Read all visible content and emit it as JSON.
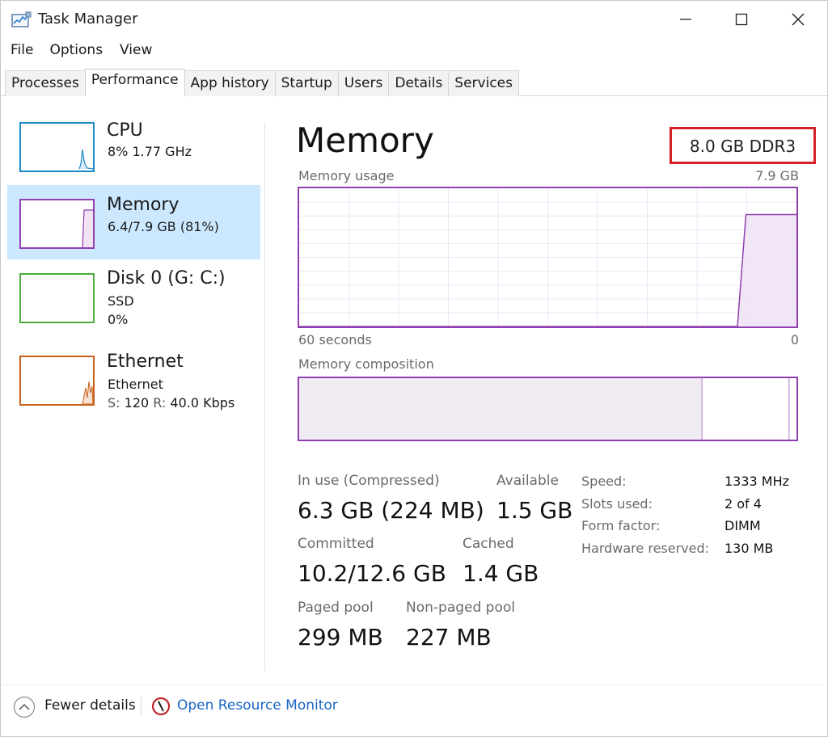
{
  "window": {
    "title": "Task Manager"
  },
  "menu": [
    "File",
    "Options",
    "View"
  ],
  "tabs": [
    "Processes",
    "Performance",
    "App history",
    "Startup",
    "Users",
    "Details",
    "Services"
  ],
  "sidebar": {
    "items": [
      {
        "title": "CPU",
        "line1": "8% 1.77 GHz",
        "line2": "",
        "color": "#1a8ac7"
      },
      {
        "title": "Memory",
        "line1": "6.4/7.9 GB (81%)",
        "line2": "",
        "color": "#8f3fb0"
      },
      {
        "title": "Disk 0 (G: C:)",
        "line1": "SSD",
        "line2": "0%",
        "color": "#4cae3a"
      },
      {
        "title": "Ethernet",
        "line1": "Ethernet",
        "line2_s": "S:",
        "line2_s_val": "120",
        "line2_r": "R:",
        "line2_r_val": "40.0 Kbps",
        "color": "#c8601b"
      }
    ]
  },
  "main": {
    "title": "Memory",
    "spec": "8.0 GB DDR3",
    "usage_label": "Memory usage",
    "usage_max": "7.9 GB",
    "time_left": "60 seconds",
    "time_right": "0",
    "composition_label": "Memory composition",
    "usage_history": [
      0,
      0,
      0,
      0,
      0,
      0,
      0,
      0,
      0,
      0,
      0,
      0,
      0,
      0,
      0,
      0,
      0,
      0,
      0,
      0,
      0,
      0,
      0,
      0,
      0,
      0,
      0,
      0,
      0,
      0,
      0,
      0,
      0,
      0,
      0,
      0,
      0,
      0,
      0,
      0,
      0,
      0,
      0,
      0,
      0,
      0,
      0,
      0,
      0,
      0,
      0,
      0,
      0,
      81,
      81,
      81,
      81,
      81,
      81,
      81
    ],
    "composition_in_use_fraction": 0.81,
    "stats": {
      "in_use_label": "In use (Compressed)",
      "in_use_value": "6.3 GB (224 MB)",
      "available_label": "Available",
      "available_value": "1.5 GB",
      "committed_label": "Committed",
      "committed_value": "10.2/12.6 GB",
      "cached_label": "Cached",
      "cached_value": "1.4 GB",
      "paged_label": "Paged pool",
      "paged_value": "299 MB",
      "nonpaged_label": "Non-paged pool",
      "nonpaged_value": "227 MB"
    },
    "specs": [
      {
        "label": "Speed:",
        "value": "1333 MHz"
      },
      {
        "label": "Slots used:",
        "value": "2 of 4"
      },
      {
        "label": "Form factor:",
        "value": "DIMM"
      },
      {
        "label": "Hardware reserved:",
        "value": "130 MB"
      }
    ]
  },
  "footer": {
    "fewer_details": "Fewer details",
    "open_resource_monitor": "Open Resource Monitor"
  },
  "colors": {
    "memory_accent": "#8f3fb0",
    "link": "#1a66c4",
    "selected_bg": "#cce8ff",
    "highlight_border": "#d61f26"
  }
}
